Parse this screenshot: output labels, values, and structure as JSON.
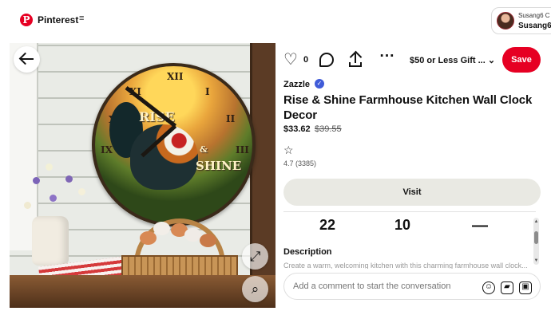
{
  "header": {
    "logo_glyph": "P",
    "brand": "Pinterest",
    "menu_icon": "≡",
    "account_small": "Susang6 C",
    "account_name": "Susang6"
  },
  "image": {
    "clock_words": [
      "RISE",
      "&",
      "SHINE"
    ],
    "numerals": [
      "XII",
      "I",
      "II",
      "III",
      "IX",
      "X",
      "XI"
    ]
  },
  "actions": {
    "like_count": "0",
    "board_label": "$50 or Less Gift ...",
    "save": "Save"
  },
  "pin": {
    "seller": "Zazzle",
    "title": "Rise & Shine Farmhouse Kitchen Wall Clock Decor",
    "price": "$33.62",
    "old_price": "$39.55",
    "rating": "4.7 (3385)",
    "visit": "Visit",
    "stats": [
      "22",
      "10",
      "—"
    ],
    "description_title": "Description",
    "description_preview": "Create a warm, welcoming kitchen with this charming farmhouse wall clock..."
  },
  "comment": {
    "placeholder": "Add a comment to start the conversation"
  },
  "colors": {
    "brand_red": "#e60023",
    "verified_blue": "#3f5bd8"
  }
}
